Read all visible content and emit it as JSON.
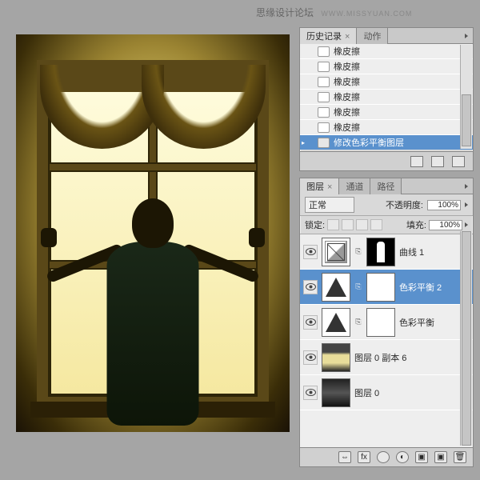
{
  "watermark": {
    "text": "思缘设计论坛",
    "url": "WWW.MISSYUAN.COM"
  },
  "history_panel": {
    "tabs": [
      {
        "label": "历史记录",
        "active": true
      },
      {
        "label": "动作",
        "active": false
      }
    ],
    "items": [
      {
        "label": "橡皮擦",
        "selected": false
      },
      {
        "label": "橡皮擦",
        "selected": false
      },
      {
        "label": "橡皮擦",
        "selected": false
      },
      {
        "label": "橡皮擦",
        "selected": false
      },
      {
        "label": "橡皮擦",
        "selected": false
      },
      {
        "label": "橡皮擦",
        "selected": false
      },
      {
        "label": "修改色彩平衡图层",
        "selected": true
      }
    ],
    "footer_icons": [
      "snapshot",
      "new",
      "trash"
    ]
  },
  "layers_panel": {
    "tabs": [
      {
        "label": "图层",
        "active": true
      },
      {
        "label": "通道",
        "active": false
      },
      {
        "label": "路径",
        "active": false
      }
    ],
    "blend_mode": "正常",
    "opacity_label": "不透明度:",
    "opacity_value": "100%",
    "lock_label": "锁定:",
    "fill_label": "填充:",
    "fill_value": "100%",
    "layers": [
      {
        "name": "曲线 1",
        "type": "curves",
        "mask": "black",
        "visible": true,
        "selected": false
      },
      {
        "name": "色彩平衡 2",
        "type": "levels",
        "mask": "white",
        "visible": true,
        "selected": true
      },
      {
        "name": "色彩平衡",
        "type": "levels",
        "mask": "white",
        "visible": true,
        "selected": false
      },
      {
        "name": "图层 0 副本 6",
        "type": "image",
        "mask": null,
        "visible": true,
        "selected": false
      },
      {
        "name": "图层 0",
        "type": "image-dark",
        "mask": null,
        "visible": true,
        "selected": false
      }
    ],
    "footer_icons": [
      "link",
      "fx",
      "mask",
      "adjust",
      "group",
      "new",
      "trash"
    ]
  }
}
